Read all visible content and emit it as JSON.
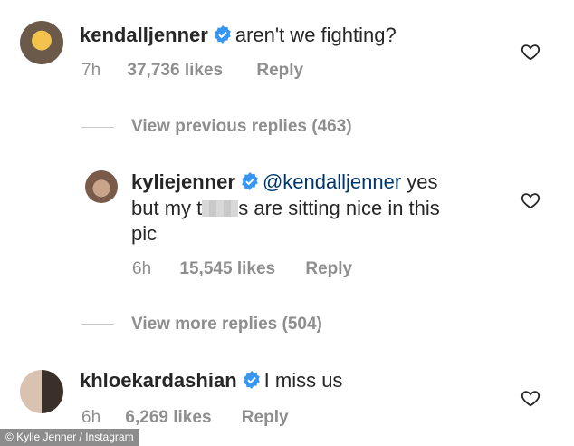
{
  "comments": [
    {
      "username": "kendalljenner",
      "text": "aren't we fighting?",
      "time": "7h",
      "likes": "37,736 likes",
      "reply": "Reply"
    },
    {
      "username": "kyliejenner",
      "mention": "@kendalljenner",
      "text_line1_rest": " yes",
      "text_line2_a": "but my t",
      "text_line2_b": "s are sitting nice in this",
      "text_line3": "pic",
      "time": "6h",
      "likes": "15,545 likes",
      "reply": "Reply"
    },
    {
      "username": "khloekardashian",
      "text": "I miss us",
      "time": "6h",
      "likes": "6,269 likes",
      "reply": "Reply"
    }
  ],
  "threads": {
    "previous": "View previous replies (463)",
    "more": "View more replies (504)"
  },
  "credit": "© Kylie Jenner / Instagram",
  "colors": {
    "verified": "#3897f0",
    "mention": "#00376b",
    "muted": "#8e8e8e"
  },
  "icons": [
    "verified-badge-icon",
    "heart-icon"
  ]
}
